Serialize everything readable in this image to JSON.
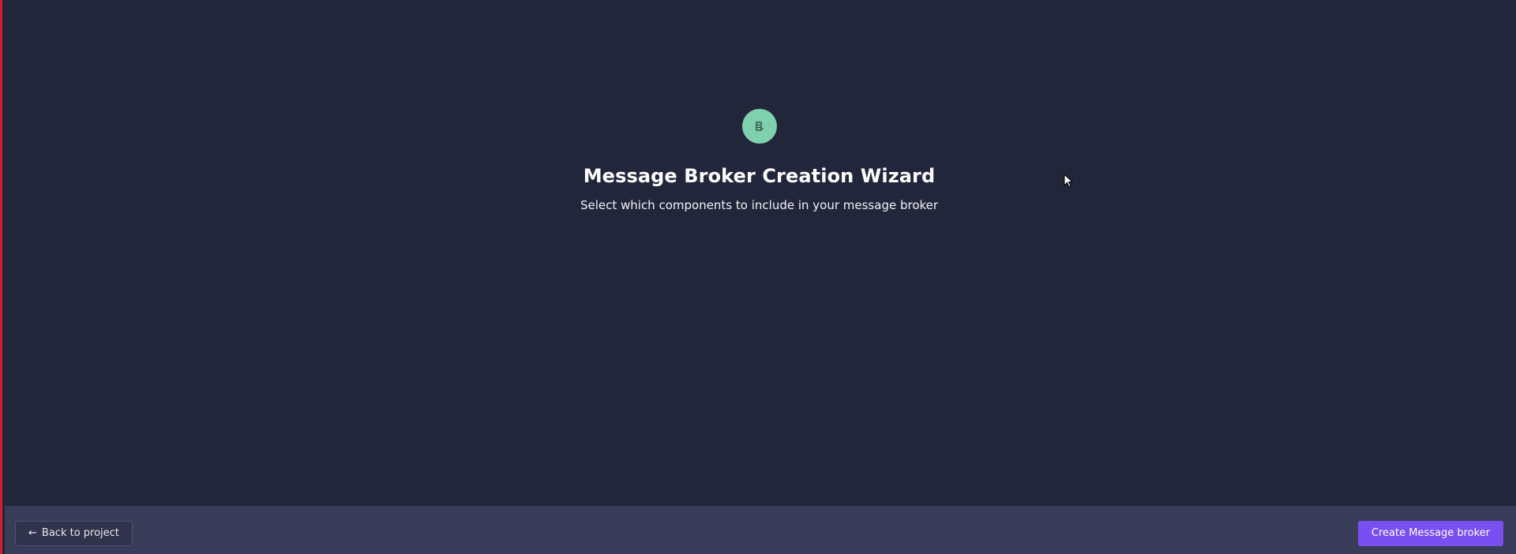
{
  "wizard": {
    "icon": "broker-icon",
    "title": "Message Broker Creation Wizard",
    "subtitle": "Select which components to include in your message broker"
  },
  "footer": {
    "back_arrow": "←",
    "back_label": "Back to project",
    "create_label": "Create Message broker"
  },
  "colors": {
    "background": "#22263a",
    "footer": "#393c58",
    "accent": "#7a4ff1",
    "badge": "#7fd1ad",
    "left_border": "#d0202e"
  }
}
